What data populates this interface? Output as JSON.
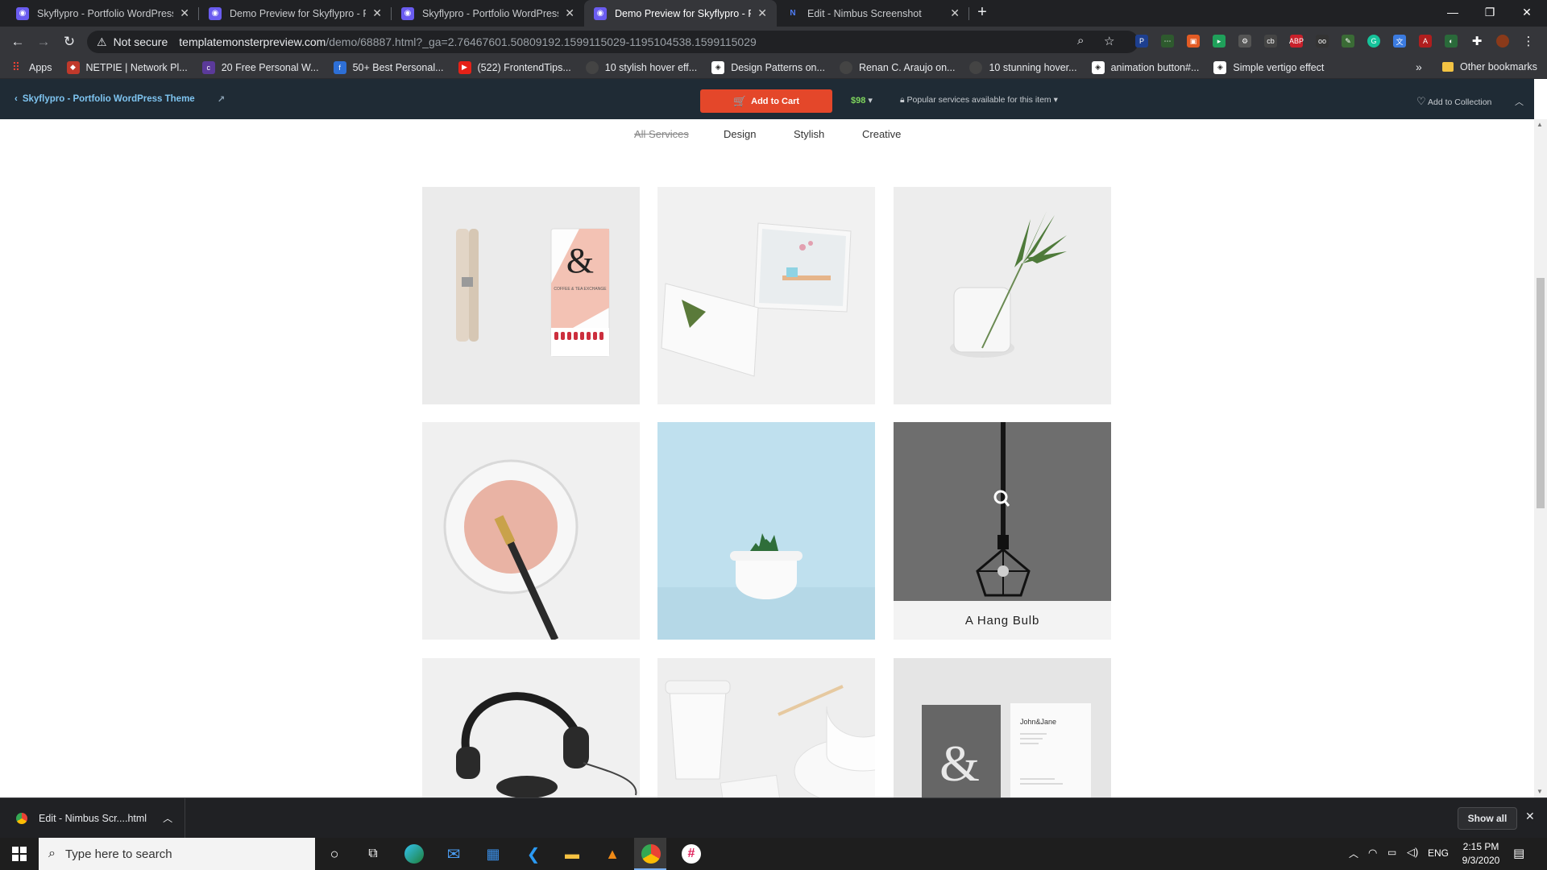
{
  "browser": {
    "tabs": [
      {
        "title": "Skyflypro - Portfolio WordPress T",
        "active": false
      },
      {
        "title": "Demo Preview for Skyflypro - Por",
        "active": false
      },
      {
        "title": "Skyflypro - Portfolio WordPress T",
        "active": false
      },
      {
        "title": "Demo Preview for Skyflypro - Por",
        "active": true
      },
      {
        "title": "Edit - Nimbus Screenshot",
        "active": false
      }
    ],
    "not_secure": "Not secure",
    "url_host": "templatemonsterpreview.com",
    "url_path": "/demo/68887.html?_ga=2.76467601.50809192.1599115029-1195104538.1599115029",
    "bookmarks": [
      "Apps",
      "NETPIE | Network Pl...",
      "20 Free Personal W...",
      "50+ Best Personal...",
      "(522) FrontendTips...",
      "10 stylish hover eff...",
      "Design Patterns on...",
      "Renan C. Araujo on...",
      "10 stunning hover...",
      "animation button#...",
      "Simple vertigo effect"
    ],
    "more_bookmarks": "»",
    "other_bookmarks": "Other bookmarks"
  },
  "tm_bar": {
    "back_label": "Skyflypro - Portfolio WordPress Theme",
    "cart_label": "Add to Cart",
    "price": "$98",
    "popular": "Popular services available for this item",
    "collection": "Add to Collection"
  },
  "filters": [
    "All Services",
    "Design",
    "Stylish",
    "Creative"
  ],
  "active_filter": "All Services",
  "portfolio": {
    "hover_caption": "A Hang Bulb",
    "card_text_coffee_sub": "COFFEE & TEA EXCHANGE",
    "card_text_business": "John&Jane"
  },
  "download": {
    "file": "Edit - Nimbus Scr....html",
    "show_all": "Show all"
  },
  "taskbar": {
    "search_placeholder": "Type here to search",
    "lang": "ENG",
    "time": "2:15 PM",
    "date": "9/3/2020"
  }
}
